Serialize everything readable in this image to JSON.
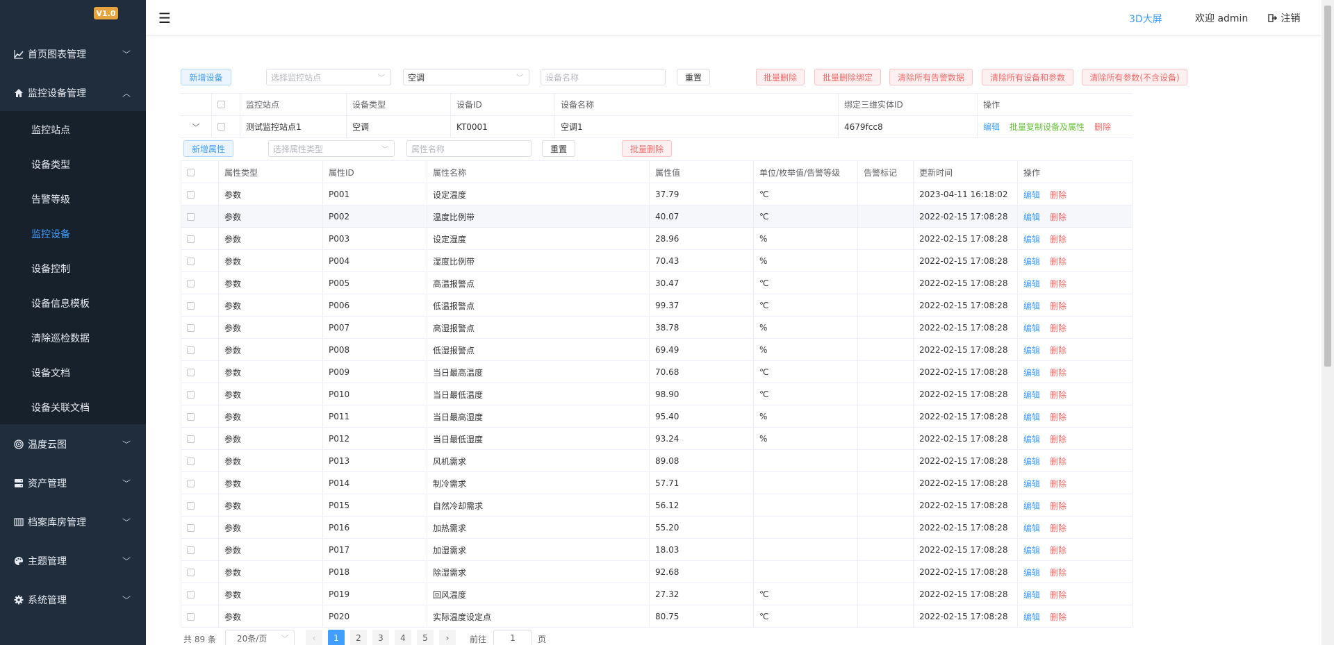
{
  "app": {
    "version": "V1.0"
  },
  "header": {
    "screen_3d": "3D大屏",
    "welcome": "欢迎 admin",
    "logout": "注销"
  },
  "sidebar": {
    "menus": [
      {
        "label": "首页图表管理",
        "icon": "chart-line-icon"
      },
      {
        "label": "监控设备管理",
        "icon": "home-icon"
      },
      {
        "label": "温度云图",
        "icon": "target-icon"
      },
      {
        "label": "资产管理",
        "icon": "server-icon"
      },
      {
        "label": "档案库房管理",
        "icon": "cabinet-icon"
      },
      {
        "label": "主题管理",
        "icon": "palette-icon"
      },
      {
        "label": "系统管理",
        "icon": "gear-icon"
      }
    ],
    "sub_items": [
      {
        "label": "监控站点"
      },
      {
        "label": "设备类型"
      },
      {
        "label": "告警等级"
      },
      {
        "label": "监控设备",
        "active": true
      },
      {
        "label": "设备控制"
      },
      {
        "label": "设备信息模板"
      },
      {
        "label": "清除巡检数据"
      },
      {
        "label": "设备文档"
      },
      {
        "label": "设备关联文档"
      }
    ]
  },
  "toolbar": {
    "add_device": "新增设备",
    "station_placeholder": "选择监控站点",
    "device_type_value": "空调",
    "device_name_placeholder": "设备名称",
    "reset": "重置",
    "batch_delete": "批量删除",
    "batch_unbind": "批量删除绑定",
    "clear_alarms": "清除所有告警数据",
    "clear_devices_params": "清除所有设备和参数",
    "clear_params": "清除所有参数(不含设备)"
  },
  "device_table": {
    "headers": [
      "监控站点",
      "设备类型",
      "设备ID",
      "设备名称",
      "绑定三维实体ID",
      "操作"
    ],
    "rows": [
      {
        "station": "测试监控站点1",
        "type": "空调",
        "id": "KT0001",
        "name": "空调1",
        "entity_id": "4679fcc8",
        "actions": {
          "edit": "编辑",
          "copy": "批量复制设备及属性",
          "delete": "删除"
        }
      }
    ]
  },
  "attr_toolbar": {
    "add_attr": "新增属性",
    "attr_type_placeholder": "选择属性类型",
    "attr_name_placeholder": "属性名称",
    "reset": "重置",
    "batch_delete": "批量删除"
  },
  "attr_table": {
    "headers": [
      "属性类型",
      "属性ID",
      "属性名称",
      "属性值",
      "单位/枚举值/告警等级",
      "告警标记",
      "更新时间",
      "操作"
    ],
    "edit_label": "编辑",
    "delete_label": "删除",
    "rows": [
      {
        "type": "参数",
        "id": "P001",
        "name": "设定温度",
        "value": "37.79",
        "unit": "℃",
        "alarm": "",
        "time": "2023-04-11 16:18:02"
      },
      {
        "type": "参数",
        "id": "P002",
        "name": "温度比例带",
        "value": "40.07",
        "unit": "℃",
        "alarm": "",
        "time": "2022-02-15 17:08:28"
      },
      {
        "type": "参数",
        "id": "P003",
        "name": "设定湿度",
        "value": "28.96",
        "unit": "%",
        "alarm": "",
        "time": "2022-02-15 17:08:28"
      },
      {
        "type": "参数",
        "id": "P004",
        "name": "湿度比例带",
        "value": "70.43",
        "unit": "%",
        "alarm": "",
        "time": "2022-02-15 17:08:28"
      },
      {
        "type": "参数",
        "id": "P005",
        "name": "高温报警点",
        "value": "30.47",
        "unit": "℃",
        "alarm": "",
        "time": "2022-02-15 17:08:28"
      },
      {
        "type": "参数",
        "id": "P006",
        "name": "低温报警点",
        "value": "99.37",
        "unit": "℃",
        "alarm": "",
        "time": "2022-02-15 17:08:28"
      },
      {
        "type": "参数",
        "id": "P007",
        "name": "高湿报警点",
        "value": "38.78",
        "unit": "%",
        "alarm": "",
        "time": "2022-02-15 17:08:28"
      },
      {
        "type": "参数",
        "id": "P008",
        "name": "低湿报警点",
        "value": "69.49",
        "unit": "%",
        "alarm": "",
        "time": "2022-02-15 17:08:28"
      },
      {
        "type": "参数",
        "id": "P009",
        "name": "当日最高温度",
        "value": "70.68",
        "unit": "℃",
        "alarm": "",
        "time": "2022-02-15 17:08:28"
      },
      {
        "type": "参数",
        "id": "P010",
        "name": "当日最低温度",
        "value": "98.90",
        "unit": "℃",
        "alarm": "",
        "time": "2022-02-15 17:08:28"
      },
      {
        "type": "参数",
        "id": "P011",
        "name": "当日最高湿度",
        "value": "95.40",
        "unit": "%",
        "alarm": "",
        "time": "2022-02-15 17:08:28"
      },
      {
        "type": "参数",
        "id": "P012",
        "name": "当日最低湿度",
        "value": "93.24",
        "unit": "%",
        "alarm": "",
        "time": "2022-02-15 17:08:28"
      },
      {
        "type": "参数",
        "id": "P013",
        "name": "风机需求",
        "value": "89.08",
        "unit": "",
        "alarm": "",
        "time": "2022-02-15 17:08:28"
      },
      {
        "type": "参数",
        "id": "P014",
        "name": "制冷需求",
        "value": "57.71",
        "unit": "",
        "alarm": "",
        "time": "2022-02-15 17:08:28"
      },
      {
        "type": "参数",
        "id": "P015",
        "name": "自然冷却需求",
        "value": "56.12",
        "unit": "",
        "alarm": "",
        "time": "2022-02-15 17:08:28"
      },
      {
        "type": "参数",
        "id": "P016",
        "name": "加热需求",
        "value": "55.20",
        "unit": "",
        "alarm": "",
        "time": "2022-02-15 17:08:28"
      },
      {
        "type": "参数",
        "id": "P017",
        "name": "加湿需求",
        "value": "18.03",
        "unit": "",
        "alarm": "",
        "time": "2022-02-15 17:08:28"
      },
      {
        "type": "参数",
        "id": "P018",
        "name": "除湿需求",
        "value": "92.68",
        "unit": "",
        "alarm": "",
        "time": "2022-02-15 17:08:28"
      },
      {
        "type": "参数",
        "id": "P019",
        "name": "回风温度",
        "value": "27.32",
        "unit": "℃",
        "alarm": "",
        "time": "2022-02-15 17:08:28"
      },
      {
        "type": "参数",
        "id": "P020",
        "name": "实际温度设定点",
        "value": "80.75",
        "unit": "℃",
        "alarm": "",
        "time": "2022-02-15 17:08:28"
      }
    ]
  },
  "pagination": {
    "total": "共 89 条",
    "page_size": "20条/页",
    "pages": [
      "1",
      "2",
      "3",
      "4",
      "5"
    ],
    "current_page": "1",
    "goto_label": "前往",
    "goto_value": "1",
    "page_suffix": "页"
  },
  "colors": {
    "sidebar_bg": "#1f2d3d",
    "accent": "#409eff",
    "danger": "#f56c6c",
    "success": "#67c23a",
    "badge": "#e6a23c"
  }
}
